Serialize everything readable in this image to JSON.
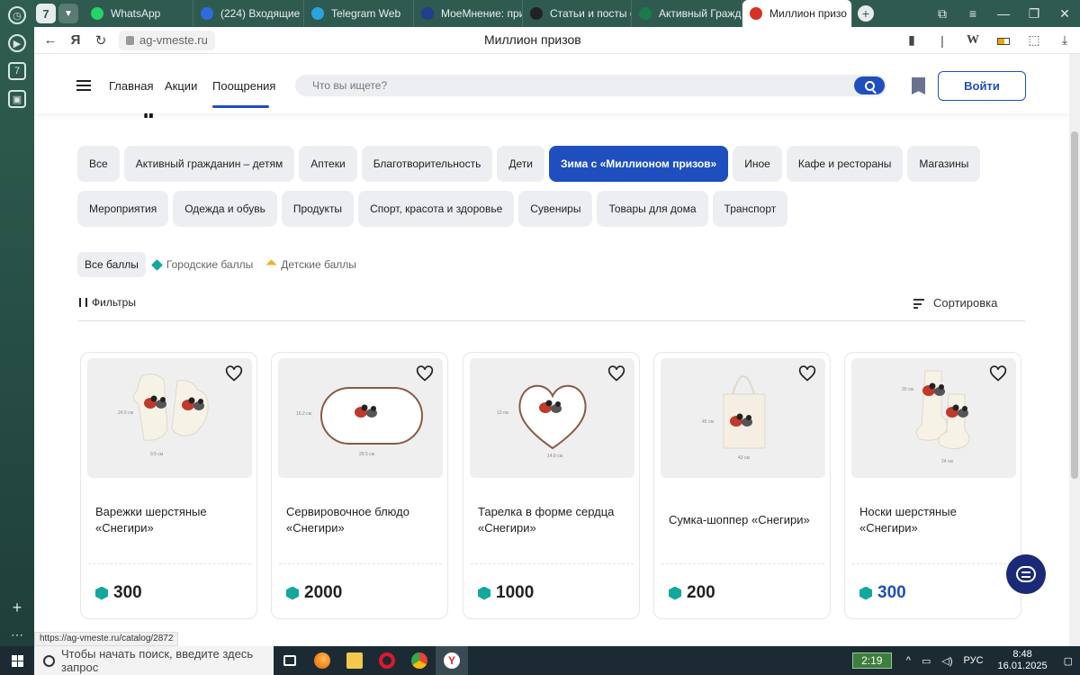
{
  "browser": {
    "tab_count": "7",
    "tabs": [
      {
        "label": "WhatsApp",
        "color": "#25d366"
      },
      {
        "label": "(224) Входящие - П",
        "color": "#2f6be0"
      },
      {
        "label": "Telegram Web",
        "color": "#2aa3e0"
      },
      {
        "label": "МоеМнение: приз",
        "color": "#1e3f8f"
      },
      {
        "label": "Статьи и посты от",
        "color": "#222222"
      },
      {
        "label": "Активный Граждан",
        "color": "#1a7a4a"
      },
      {
        "label": "Миллион призо",
        "color": "#d93025"
      }
    ],
    "url": "ag-vmeste.ru",
    "page_title": "Миллион призов",
    "status_url": "https://ag-vmeste.ru/catalog/2872"
  },
  "header": {
    "nav": [
      "Главная",
      "Акции",
      "Поощрения"
    ],
    "search_placeholder": "Что вы ищете?",
    "login": "Войти"
  },
  "page_title": "Поощрения",
  "categories": [
    {
      "label": "Все",
      "selected": false
    },
    {
      "label": "Активный гражданин – детям",
      "selected": false
    },
    {
      "label": "Аптеки",
      "selected": false
    },
    {
      "label": "Благотворительность",
      "selected": false
    },
    {
      "label": "Дети",
      "selected": false
    },
    {
      "label": "Зима с «Миллионом призов»",
      "selected": true
    },
    {
      "label": "Иное",
      "selected": false
    },
    {
      "label": "Кафе и рестораны",
      "selected": false
    },
    {
      "label": "Магазины",
      "selected": false
    },
    {
      "label": "Мероприятия",
      "selected": false
    },
    {
      "label": "Одежда и обувь",
      "selected": false
    },
    {
      "label": "Продукты",
      "selected": false
    },
    {
      "label": "Спорт, красота и здоровье",
      "selected": false
    },
    {
      "label": "Сувениры",
      "selected": false
    },
    {
      "label": "Товары для дома",
      "selected": false
    },
    {
      "label": "Транспорт",
      "selected": false
    }
  ],
  "point_types": [
    "Все баллы",
    "Городские баллы",
    "Детские баллы"
  ],
  "filters_label": "Фильтры",
  "sort_label": "Сортировка",
  "products": [
    {
      "name": "Варежки шерстяные «Снегири»",
      "price": "300",
      "image": "mittens",
      "dims": [
        "24.5 см",
        "9.5 см"
      ]
    },
    {
      "name": "Сервировочное блюдо «Снегири»",
      "price": "2000",
      "image": "oval-dish",
      "dims": [
        "16.2 см",
        "29.5 см"
      ]
    },
    {
      "name": "Тарелка в форме сердца «Снегири»",
      "price": "1000",
      "image": "heart-plate",
      "dims": [
        "13 см",
        "14.8 см"
      ]
    },
    {
      "name": "Сумка-шоппер «Снегири»",
      "price": "200",
      "image": "tote-bag",
      "dims": [
        "45 см",
        "43 см"
      ]
    },
    {
      "name": "Носки шерстяные «Снегири»",
      "price": "300",
      "image": "socks",
      "dims": [
        "20 см",
        "24 см"
      ]
    }
  ],
  "taskbar": {
    "search_placeholder": "Чтобы начать поиск, введите здесь запрос",
    "timer": "2:19",
    "lang": "РУС",
    "time": "8:48",
    "date": "16.01.2025"
  }
}
